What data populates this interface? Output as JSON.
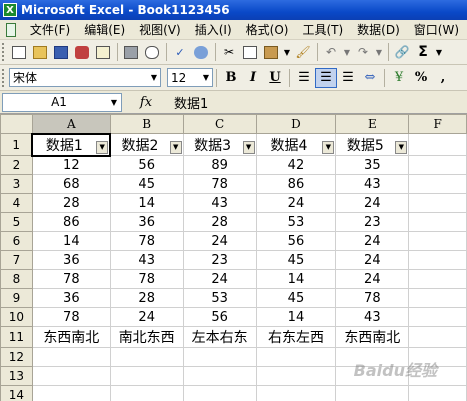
{
  "app": {
    "title": "Microsoft Excel - Book1123456",
    "icon_name": "excel-icon"
  },
  "menu": [
    "文件(F)",
    "编辑(E)",
    "视图(V)",
    "插入(I)",
    "格式(O)",
    "工具(T)",
    "数据(D)",
    "窗口(W)"
  ],
  "toolbar": {
    "standard_icons": [
      "new-icon",
      "open-icon",
      "save-icon",
      "permission-icon",
      "email-icon",
      "print-icon",
      "print-preview-icon",
      "spelling-icon",
      "research-icon",
      "cut-icon",
      "copy-icon",
      "paste-icon",
      "format-painter-icon",
      "undo-icon",
      "redo-icon",
      "sum-icon"
    ],
    "font_name": "宋体",
    "font_size": "12",
    "bold_label": "B",
    "italic_label": "I",
    "underline_label": "U",
    "percent_label": "%",
    "comma_label": ",",
    "sum_label": "Σ",
    "align_center_active": true
  },
  "formula_bar": {
    "name_box": "A1",
    "fx_label": "fx",
    "content": "数据1"
  },
  "sheet": {
    "columns": [
      "A",
      "B",
      "C",
      "D",
      "E",
      "F"
    ],
    "row_numbers": [
      "1",
      "2",
      "3",
      "4",
      "5",
      "6",
      "7",
      "8",
      "9",
      "10",
      "11",
      "12",
      "13",
      "14"
    ],
    "headers": [
      "数据1",
      "数据2",
      "数据3",
      "数据4",
      "数据5"
    ],
    "rows": [
      [
        "12",
        "56",
        "89",
        "42",
        "35"
      ],
      [
        "68",
        "45",
        "78",
        "86",
        "43"
      ],
      [
        "28",
        "14",
        "43",
        "24",
        "24"
      ],
      [
        "86",
        "36",
        "28",
        "53",
        "23"
      ],
      [
        "14",
        "78",
        "24",
        "56",
        "24"
      ],
      [
        "36",
        "43",
        "23",
        "45",
        "24"
      ],
      [
        "78",
        "78",
        "24",
        "14",
        "24"
      ],
      [
        "36",
        "28",
        "53",
        "45",
        "78"
      ],
      [
        "78",
        "24",
        "56",
        "14",
        "43"
      ]
    ],
    "text_row": [
      "东西南北",
      "南北东西",
      "左本右东",
      "右东左西",
      "东西南北"
    ]
  },
  "watermark": "Baidu经验"
}
